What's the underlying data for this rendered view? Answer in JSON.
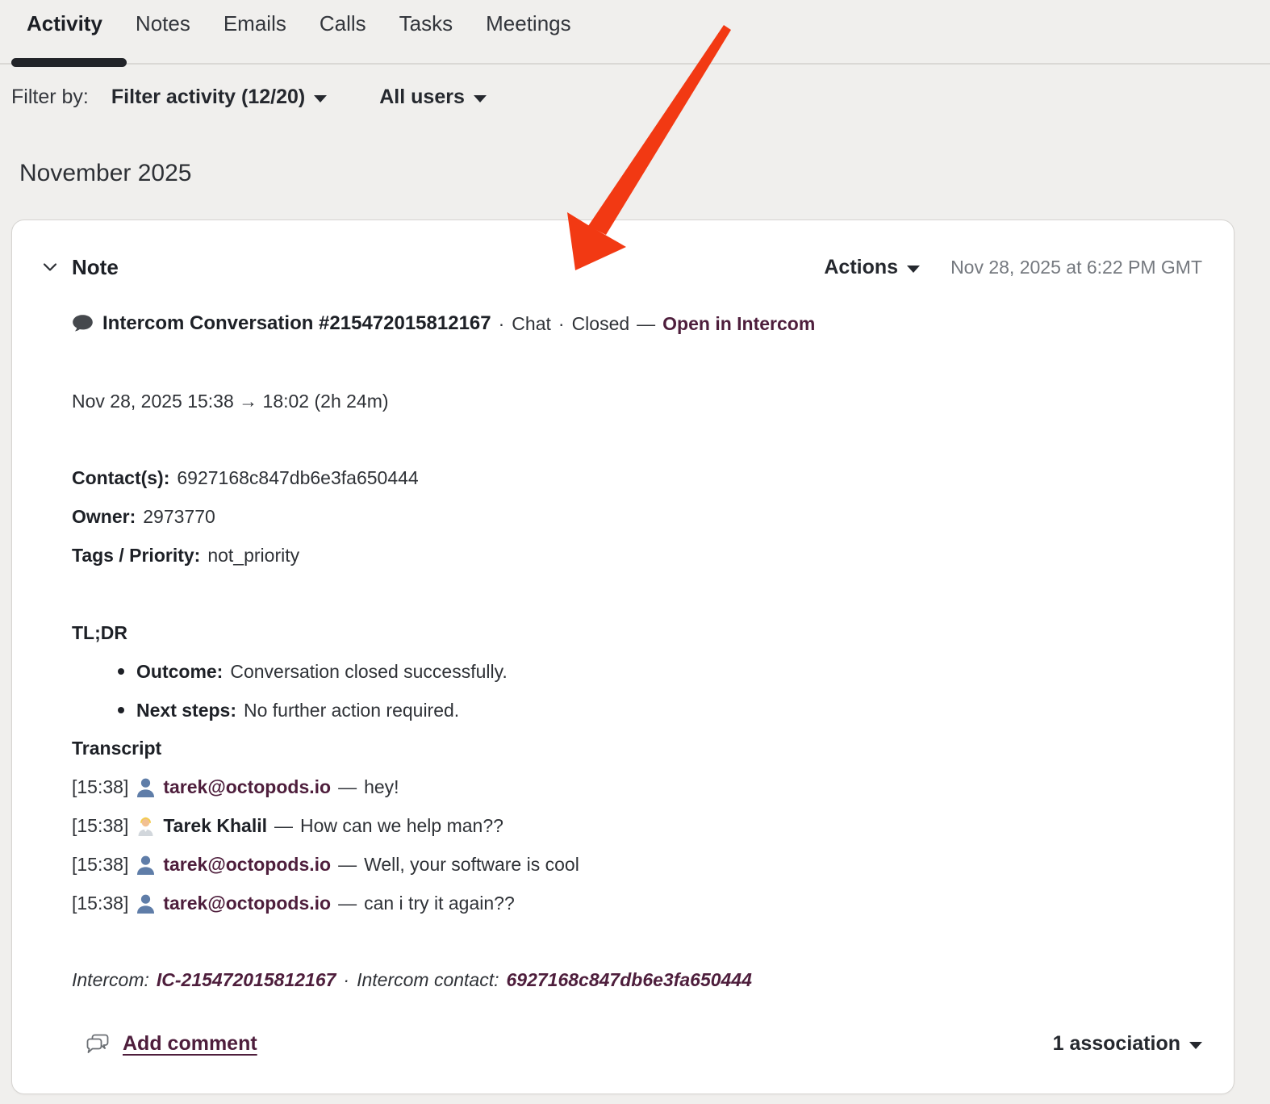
{
  "tabs": {
    "items": [
      {
        "label": "Activity",
        "active": true
      },
      {
        "label": "Notes",
        "active": false
      },
      {
        "label": "Emails",
        "active": false
      },
      {
        "label": "Calls",
        "active": false
      },
      {
        "label": "Tasks",
        "active": false
      },
      {
        "label": "Meetings",
        "active": false
      }
    ]
  },
  "filter_bar": {
    "label": "Filter by:",
    "activity_filter": "Filter activity (12/20)",
    "user_filter": "All users"
  },
  "month_heading": "November 2025",
  "note_card": {
    "type_label": "Note",
    "actions_label": "Actions",
    "timestamp": "Nov 28, 2025 at 6:22 PM GMT",
    "title": {
      "icon": "speech-bubble-icon",
      "name": "Intercom Conversation #215472015812167",
      "sep1": "·",
      "channel": "Chat",
      "sep2": "·",
      "status": "Closed",
      "dash": "—",
      "link": "Open in Intercom"
    },
    "time_range": "Nov 28, 2025 15:38 → 18:02 (2h 24m)",
    "details": [
      {
        "label": "Contact(s):",
        "value": "6927168c847db6e3fa650444"
      },
      {
        "label": "Owner:",
        "value": "2973770"
      },
      {
        "label": "Tags / Priority:",
        "value": "not_priority"
      }
    ],
    "tldr": {
      "heading": "TL;DR",
      "bullets": [
        {
          "label": "Outcome:",
          "text": "Conversation closed successfully."
        },
        {
          "label": "Next steps:",
          "text": "No further action required."
        }
      ]
    },
    "transcript": {
      "heading": "Transcript",
      "lines": [
        {
          "time": "[15:38]",
          "icon": "bust-silhouette-emoji",
          "speaker": "tarek@octopods.io",
          "dash": "—",
          "message": "hey!"
        },
        {
          "time": "[15:38]",
          "icon": "person-emoji",
          "speaker": "Tarek Khalil",
          "dash": "—",
          "message": "How can we help man??"
        },
        {
          "time": "[15:38]",
          "icon": "bust-silhouette-emoji",
          "speaker": "tarek@octopods.io",
          "dash": "—",
          "message": "Well, your software is cool"
        },
        {
          "time": "[15:38]",
          "icon": "bust-silhouette-emoji",
          "speaker": "tarek@octopods.io",
          "dash": "—",
          "message": "can i try it again??"
        }
      ]
    },
    "footer_refs": {
      "intercom_label": "Intercom:",
      "intercom_id": "IC-215472015812167",
      "separator": "·",
      "contact_label": "Intercom contact:",
      "contact_id": "6927168c847db6e3fa650444"
    },
    "add_comment_label": "Add comment",
    "associations_label": "1 association"
  },
  "annotation": {
    "shape": "red-arrow",
    "color": "#f23913"
  },
  "colors": {
    "accent_link": "#4e1e3c",
    "page_background": "#f0efed",
    "card_background": "#ffffff",
    "timestamp_gray": "#75797f"
  }
}
